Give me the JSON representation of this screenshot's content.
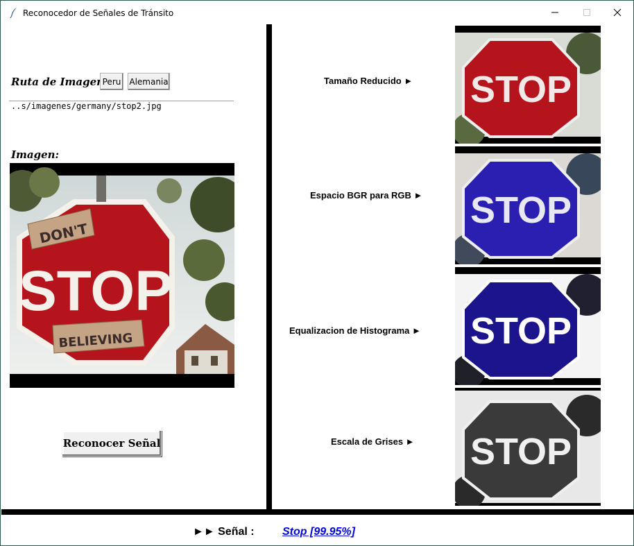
{
  "window": {
    "title": "Reconocedor de Señales de Tránsito",
    "app_icon": "feather-icon",
    "controls": [
      "minimize-icon",
      "maximize-icon",
      "close-icon"
    ]
  },
  "left_panel": {
    "path_label": "Ruta de Imagen:",
    "buttons": {
      "peru": "Peru",
      "alemania": "Alemania"
    },
    "path_value": "..s/imagenes/germany/stop2.jpg",
    "image_label": "Imagen:",
    "image": {
      "sign_text": "STOP",
      "top_sticker": "DON'T",
      "bottom_sticker": "BELIEVING"
    },
    "recognize_button": "Reconocer Señal"
  },
  "right_panel": {
    "steps": [
      {
        "label": "Tamaño Reducido ►"
      },
      {
        "label": "Espacio BGR para RGB ►"
      },
      {
        "label": "Equalizacion de Histograma ►"
      },
      {
        "label": "Escala de Grises ►"
      }
    ]
  },
  "result": {
    "label": "►► Señal :",
    "value": "Stop [99.95%]"
  },
  "colors": {
    "red_sign": "#b5141c",
    "blue_sign": "#2a1fb0",
    "deep_blue_sign": "#1c148c",
    "gray_sign": "#3a3a3a",
    "link": "#0000ee"
  }
}
